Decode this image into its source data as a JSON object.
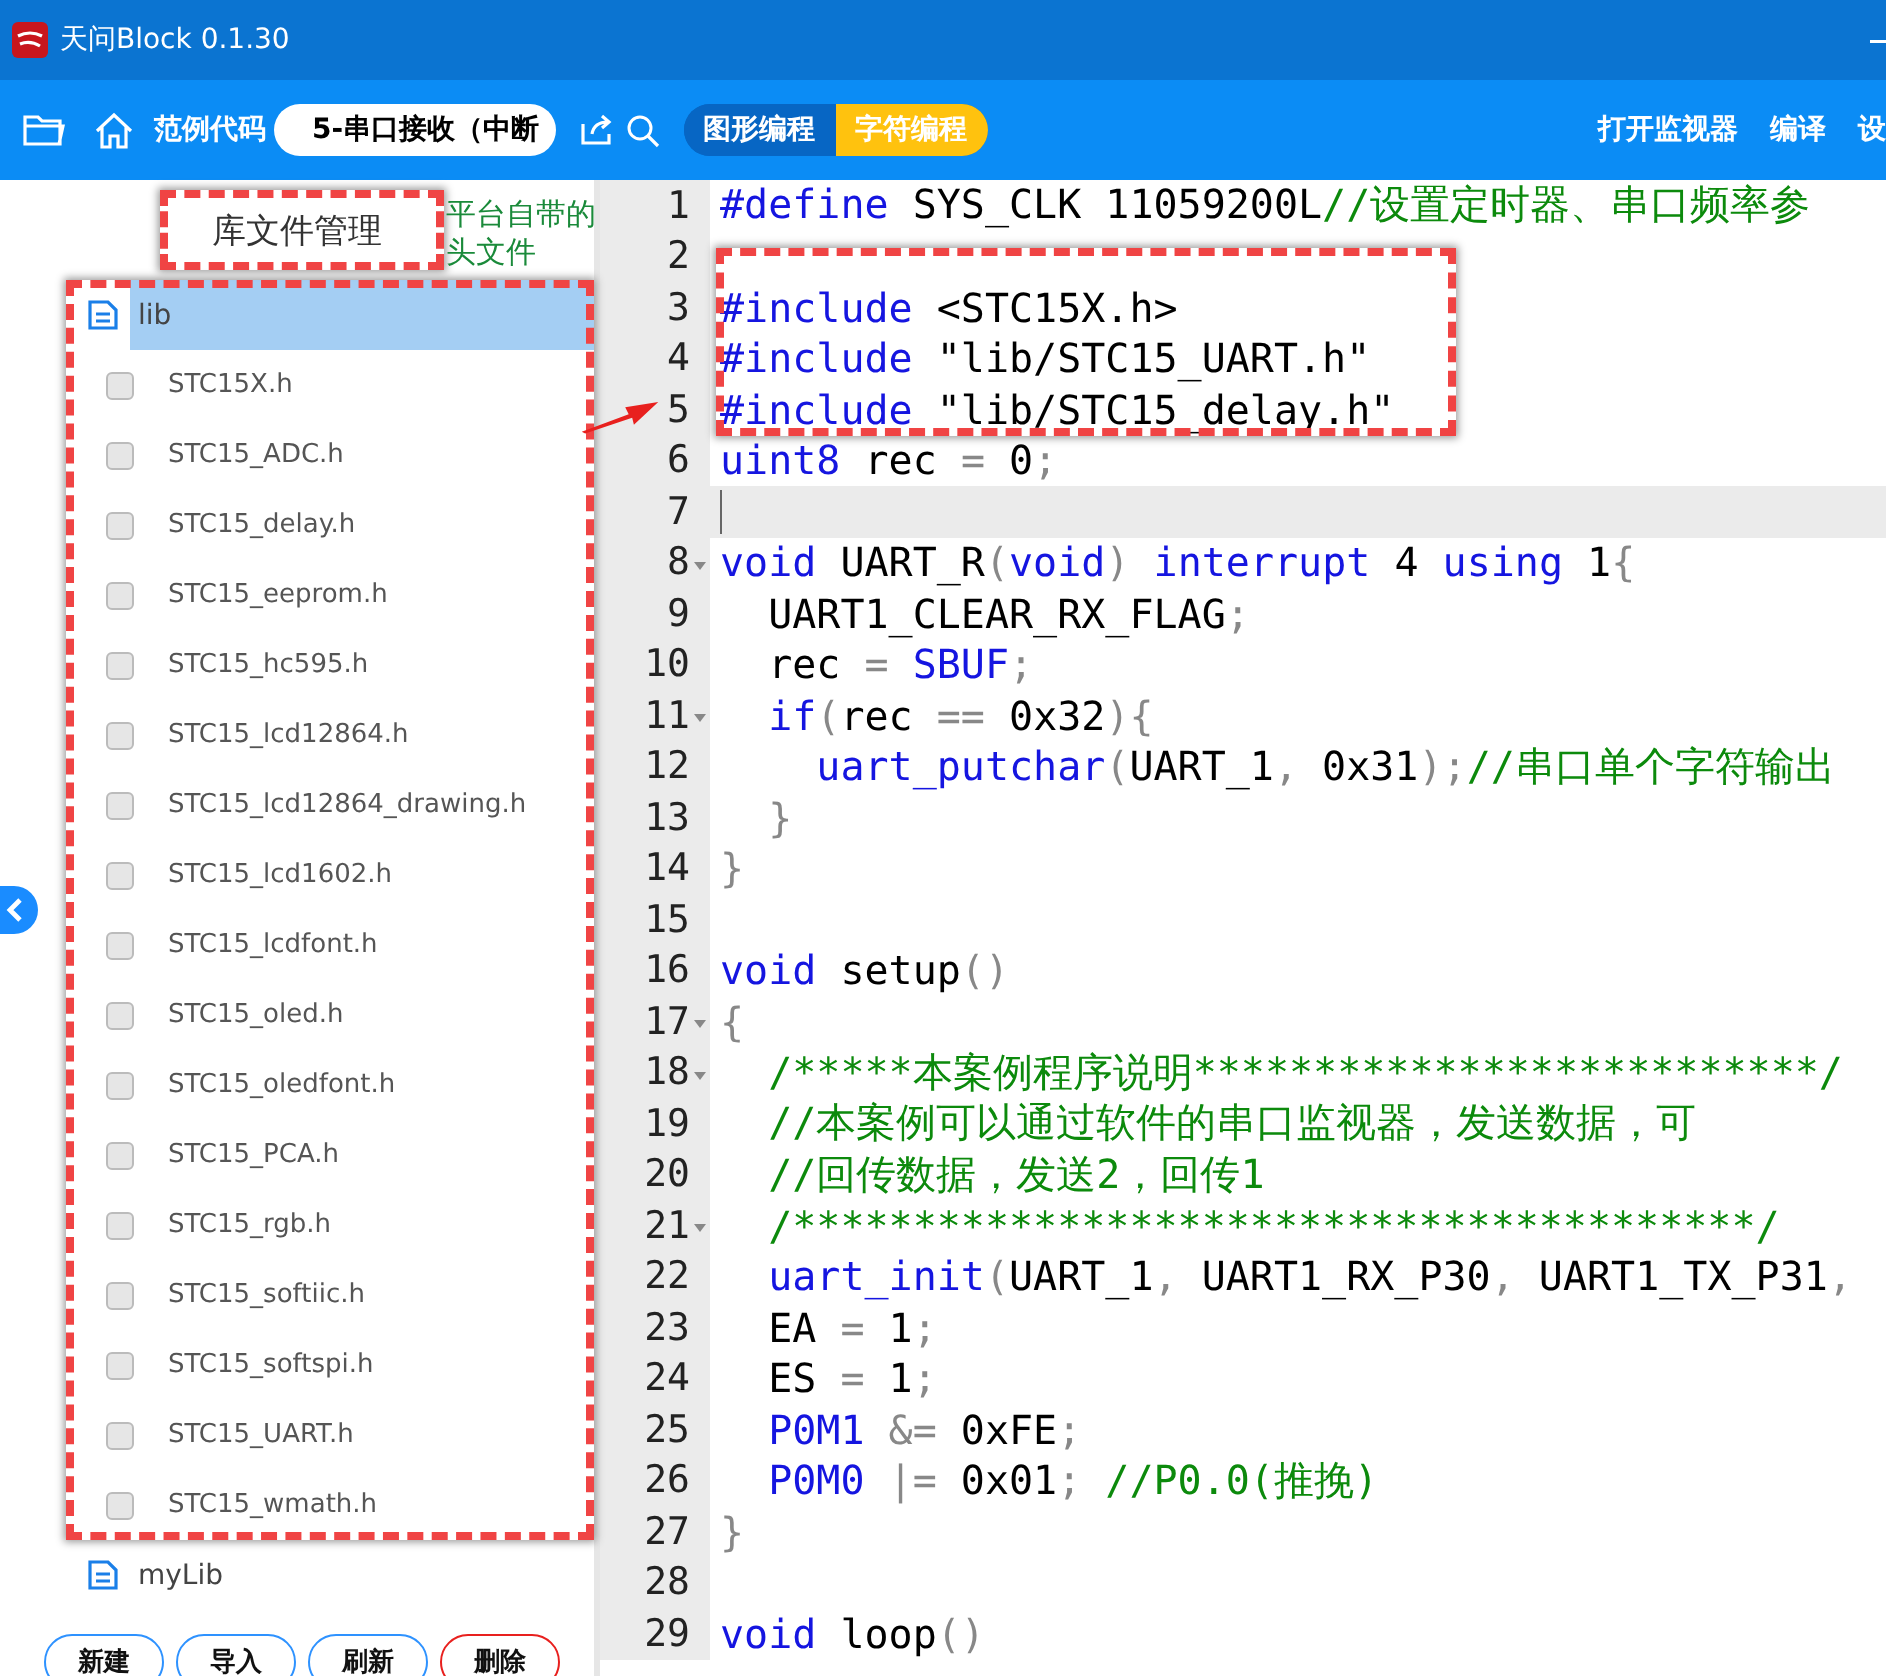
{
  "window": {
    "title": "天问Block 0.1.30"
  },
  "toolbar": {
    "example_label": "范例代码",
    "example_field": "5-串口接收（中断",
    "mode_tabs": [
      {
        "label": "图形编程",
        "selected": false
      },
      {
        "label": "字符编程",
        "selected": true
      }
    ],
    "actions": [
      "打开监视器",
      "编译",
      "设"
    ]
  },
  "library_panel": {
    "title": "库文件管理",
    "tree": [
      {
        "label": "lib",
        "selected": true,
        "children": [
          {
            "label": "STC15X.h",
            "checked": false
          },
          {
            "label": "STC15_ADC.h",
            "checked": false
          },
          {
            "label": "STC15_delay.h",
            "checked": false
          },
          {
            "label": "STC15_eeprom.h",
            "checked": false
          },
          {
            "label": "STC15_hc595.h",
            "checked": false
          },
          {
            "label": "STC15_lcd12864.h",
            "checked": false
          },
          {
            "label": "STC15_lcd12864_drawing.h",
            "checked": false
          },
          {
            "label": "STC15_lcd1602.h",
            "checked": false
          },
          {
            "label": "STC15_lcdfont.h",
            "checked": false
          },
          {
            "label": "STC15_oled.h",
            "checked": false
          },
          {
            "label": "STC15_oledfont.h",
            "checked": false
          },
          {
            "label": "STC15_PCA.h",
            "checked": false
          },
          {
            "label": "STC15_rgb.h",
            "checked": false
          },
          {
            "label": "STC15_softiic.h",
            "checked": false
          },
          {
            "label": "STC15_softspi.h",
            "checked": false
          },
          {
            "label": "STC15_UART.h",
            "checked": false
          },
          {
            "label": "STC15_wmath.h",
            "checked": false
          }
        ]
      },
      {
        "label": "myLib",
        "selected": false
      }
    ],
    "buttons": [
      {
        "label": "新建",
        "kind": "normal"
      },
      {
        "label": "导入",
        "kind": "normal"
      },
      {
        "label": "刷新",
        "kind": "normal"
      },
      {
        "label": "删除",
        "kind": "danger"
      }
    ]
  },
  "editor": {
    "lines": [
      {
        "number": "1",
        "fold": false,
        "current": false,
        "tokens": [
          {
            "kind": "kw",
            "text": "#define"
          },
          {
            "kind": "plain",
            "text": " SYS_CLK 11059200L"
          },
          {
            "kind": "comment",
            "text": "//设置定时器、串口频率参"
          }
        ]
      },
      {
        "number": "2",
        "fold": false,
        "current": false
      },
      {
        "number": "3",
        "fold": false,
        "current": false,
        "tokens": [
          {
            "kind": "kw",
            "text": "#include"
          },
          {
            "kind": "plain",
            "text": " <STC15X.h>"
          }
        ]
      },
      {
        "number": "4",
        "fold": false,
        "current": false,
        "tokens": [
          {
            "kind": "kw",
            "text": "#include"
          },
          {
            "kind": "plain",
            "text": " \"lib/STC15_UART.h\""
          }
        ]
      },
      {
        "number": "5",
        "fold": false,
        "current": false,
        "tokens": [
          {
            "kind": "kw",
            "text": "#include"
          },
          {
            "kind": "plain",
            "text": " \"lib/STC15_delay.h\""
          }
        ]
      },
      {
        "number": "6",
        "fold": false,
        "current": false,
        "tokens": [
          {
            "kind": "kw",
            "text": "uint8"
          },
          {
            "kind": "plain",
            "text": " rec "
          },
          {
            "kind": "punct",
            "text": "="
          },
          {
            "kind": "plain",
            "text": " 0"
          },
          {
            "kind": "punct",
            "text": ";"
          }
        ]
      },
      {
        "number": "7",
        "fold": false,
        "current": true
      },
      {
        "number": "8",
        "fold": true,
        "current": false,
        "tokens": [
          {
            "kind": "kw",
            "text": "void"
          },
          {
            "kind": "plain",
            "text": " UART_R"
          },
          {
            "kind": "punct",
            "text": "("
          },
          {
            "kind": "kw",
            "text": "void"
          },
          {
            "kind": "punct",
            "text": ")"
          },
          {
            "kind": "kw",
            "text": " interrupt"
          },
          {
            "kind": "plain",
            "text": " 4 "
          },
          {
            "kind": "kw",
            "text": "using"
          },
          {
            "kind": "plain",
            "text": " 1"
          },
          {
            "kind": "punct",
            "text": "{"
          }
        ]
      },
      {
        "number": "9",
        "fold": false,
        "current": false,
        "tokens": [
          {
            "kind": "plain",
            "text": "  UART1_CLEAR_RX_FLAG"
          },
          {
            "kind": "punct",
            "text": ";"
          }
        ]
      },
      {
        "number": "10",
        "fold": false,
        "current": false,
        "tokens": [
          {
            "kind": "plain",
            "text": "  rec "
          },
          {
            "kind": "punct",
            "text": "="
          },
          {
            "kind": "kw",
            "text": " SBUF"
          },
          {
            "kind": "punct",
            "text": ";"
          }
        ]
      },
      {
        "number": "11",
        "fold": true,
        "current": false,
        "tokens": [
          {
            "kind": "kw",
            "text": "  if"
          },
          {
            "kind": "punct",
            "text": "("
          },
          {
            "kind": "plain",
            "text": "rec "
          },
          {
            "kind": "punct",
            "text": "=="
          },
          {
            "kind": "plain",
            "text": " 0x32"
          },
          {
            "kind": "punct",
            "text": "){"
          }
        ]
      },
      {
        "number": "12",
        "fold": false,
        "current": false,
        "tokens": [
          {
            "kind": "kw",
            "text": "    uart_putchar"
          },
          {
            "kind": "punct",
            "text": "("
          },
          {
            "kind": "plain",
            "text": "UART_1"
          },
          {
            "kind": "punct",
            "text": ","
          },
          {
            "kind": "plain",
            "text": " 0x31"
          },
          {
            "kind": "punct",
            "text": ");"
          },
          {
            "kind": "comment",
            "text": "//串口单个字符输出"
          }
        ]
      },
      {
        "number": "13",
        "fold": false,
        "current": false,
        "tokens": [
          {
            "kind": "punct",
            "text": "  }"
          }
        ]
      },
      {
        "number": "14",
        "fold": false,
        "current": false,
        "tokens": [
          {
            "kind": "punct",
            "text": "}"
          }
        ]
      },
      {
        "number": "15",
        "fold": false,
        "current": false
      },
      {
        "number": "16",
        "fold": false,
        "current": false,
        "tokens": [
          {
            "kind": "kw",
            "text": "void"
          },
          {
            "kind": "plain",
            "text": " setup"
          },
          {
            "kind": "punct",
            "text": "()"
          }
        ]
      },
      {
        "number": "17",
        "fold": true,
        "current": false,
        "tokens": [
          {
            "kind": "punct",
            "text": "{"
          }
        ]
      },
      {
        "number": "18",
        "fold": true,
        "current": false,
        "tokens": [
          {
            "kind": "comment",
            "text": "  /*****本案例程序说明**************************/"
          }
        ]
      },
      {
        "number": "19",
        "fold": false,
        "current": false,
        "tokens": [
          {
            "kind": "comment",
            "text": "  //本案例可以通过软件的串口监视器，发送数据，可"
          }
        ]
      },
      {
        "number": "20",
        "fold": false,
        "current": false,
        "tokens": [
          {
            "kind": "comment",
            "text": "  //回传数据，发送2，回传1"
          }
        ]
      },
      {
        "number": "21",
        "fold": true,
        "current": false,
        "tokens": [
          {
            "kind": "comment",
            "text": "  /****************************************/"
          }
        ]
      },
      {
        "number": "22",
        "fold": false,
        "current": false,
        "tokens": [
          {
            "kind": "kw",
            "text": "  uart_init"
          },
          {
            "kind": "punct",
            "text": "("
          },
          {
            "kind": "plain",
            "text": "UART_1"
          },
          {
            "kind": "punct",
            "text": ","
          },
          {
            "kind": "plain",
            "text": " UART1_RX_P30"
          },
          {
            "kind": "punct",
            "text": ","
          },
          {
            "kind": "plain",
            "text": " UART1_TX_P31"
          },
          {
            "kind": "punct",
            "text": ","
          }
        ]
      },
      {
        "number": "23",
        "fold": false,
        "current": false,
        "tokens": [
          {
            "kind": "plain",
            "text": "  EA "
          },
          {
            "kind": "punct",
            "text": "="
          },
          {
            "kind": "plain",
            "text": " 1"
          },
          {
            "kind": "punct",
            "text": ";"
          }
        ]
      },
      {
        "number": "24",
        "fold": false,
        "current": false,
        "tokens": [
          {
            "kind": "plain",
            "text": "  ES "
          },
          {
            "kind": "punct",
            "text": "="
          },
          {
            "kind": "plain",
            "text": " 1"
          },
          {
            "kind": "punct",
            "text": ";"
          }
        ]
      },
      {
        "number": "25",
        "fold": false,
        "current": false,
        "tokens": [
          {
            "kind": "kw",
            "text": "  P0M1"
          },
          {
            "kind": "punct",
            "text": " &="
          },
          {
            "kind": "plain",
            "text": " 0xFE"
          },
          {
            "kind": "punct",
            "text": ";"
          }
        ]
      },
      {
        "number": "26",
        "fold": false,
        "current": false,
        "tokens": [
          {
            "kind": "kw",
            "text": "  P0M0"
          },
          {
            "kind": "punct",
            "text": " |="
          },
          {
            "kind": "plain",
            "text": " 0x01"
          },
          {
            "kind": "punct",
            "text": ";"
          },
          {
            "kind": "comment",
            "text": " //P0.0(推挽)"
          }
        ]
      },
      {
        "number": "27",
        "fold": false,
        "current": false,
        "tokens": [
          {
            "kind": "punct",
            "text": "}"
          }
        ]
      },
      {
        "number": "28",
        "fold": false,
        "current": false
      },
      {
        "number": "29",
        "fold": false,
        "current": false,
        "tokens": [
          {
            "kind": "kw",
            "text": "void"
          },
          {
            "kind": "plain",
            "text": " loop"
          },
          {
            "kind": "punct",
            "text": "()"
          }
        ]
      }
    ]
  },
  "annotation": {
    "note": "平台自带的头文件"
  }
}
